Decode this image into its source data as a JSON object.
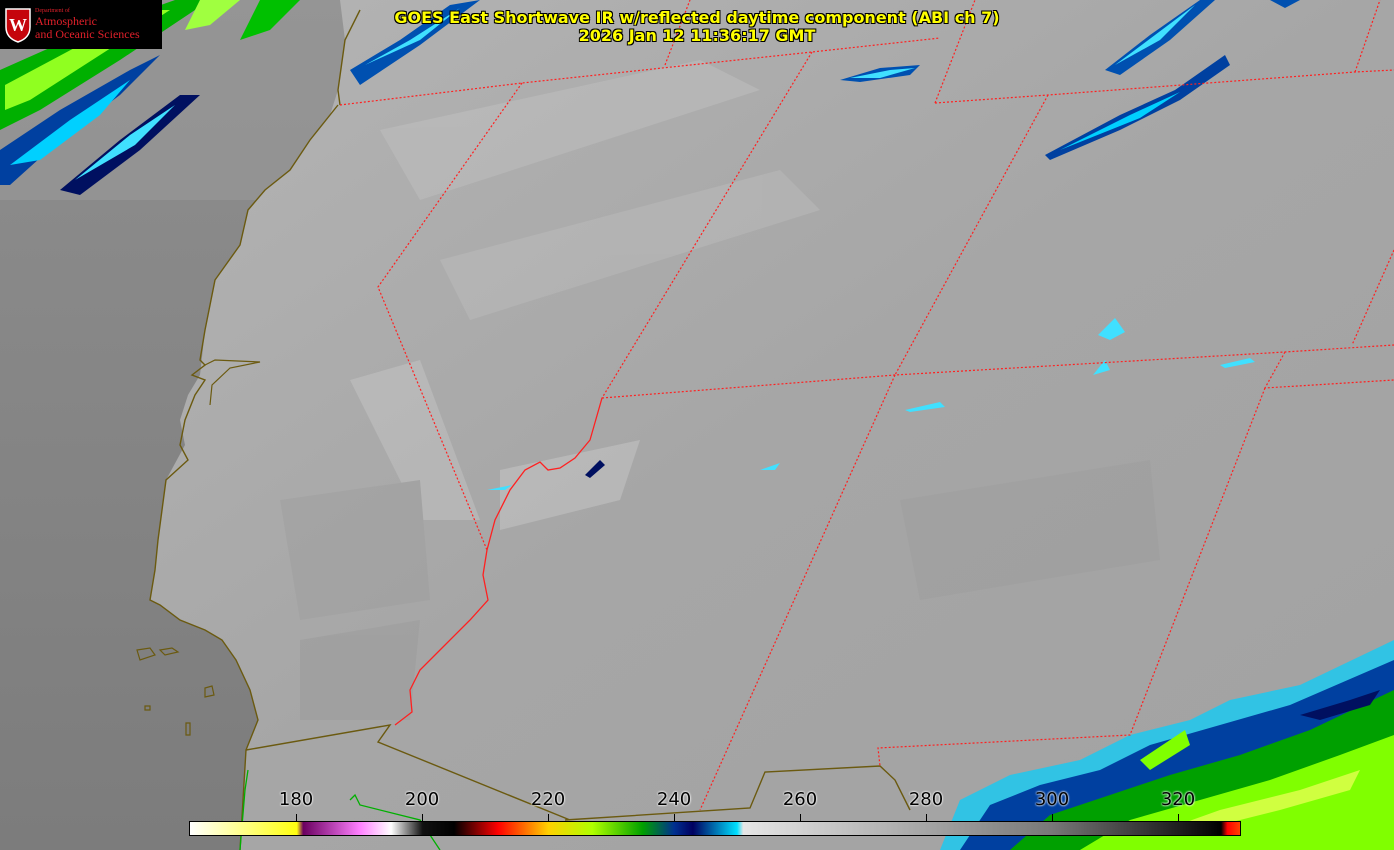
{
  "title": {
    "line1": "GOES East Shortwave IR w/reflected daytime component (ABI ch 7)",
    "line2": "2026 Jan 12 11:36:17 GMT"
  },
  "logo": {
    "dept": "Department of",
    "line1": "Atmospheric",
    "line2": "and Oceanic Sciences",
    "crest_letter": "W"
  },
  "colorbar": {
    "min": 163,
    "max": 330,
    "ticks": [
      "180",
      "200",
      "220",
      "240",
      "260",
      "280",
      "300",
      "320"
    ],
    "stops": [
      {
        "v": 163,
        "c": "#ffffff"
      },
      {
        "v": 180,
        "c": "#ffff10"
      },
      {
        "v": 181,
        "c": "#6a0060"
      },
      {
        "v": 190,
        "c": "#ff80ff"
      },
      {
        "v": 195,
        "c": "#ffffff"
      },
      {
        "v": 200,
        "c": "#101010"
      },
      {
        "v": 205,
        "c": "#000000"
      },
      {
        "v": 212,
        "c": "#ff0000"
      },
      {
        "v": 220,
        "c": "#ffd000"
      },
      {
        "v": 227,
        "c": "#b0ff00"
      },
      {
        "v": 235,
        "c": "#00a000"
      },
      {
        "v": 240,
        "c": "#003090"
      },
      {
        "v": 243,
        "c": "#000060"
      },
      {
        "v": 250,
        "c": "#00e0ff"
      },
      {
        "v": 251,
        "c": "#e6e6e6"
      },
      {
        "v": 300,
        "c": "#787878"
      },
      {
        "v": 327,
        "c": "#000000"
      },
      {
        "v": 328,
        "c": "#ff0000"
      },
      {
        "v": 330,
        "c": "#ff4000"
      }
    ]
  },
  "colors": {
    "background": "#7e7e7e",
    "title_text": "#ffff00",
    "state_borders": "#ff2020",
    "coastline": "#6b5a10",
    "logo_red": "#e0202a"
  }
}
